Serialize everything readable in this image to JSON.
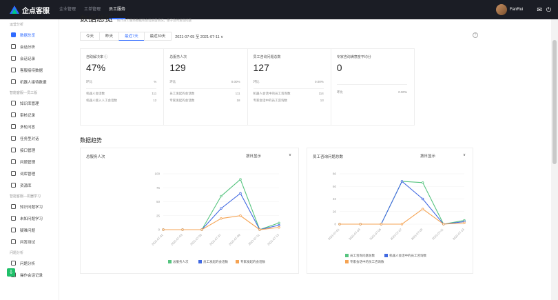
{
  "topbar": {
    "logo_text": "企点客服",
    "nav": [
      "企业管理",
      "工单管理",
      "员工服务"
    ],
    "active_nav": 2,
    "user_name": "FanRui",
    "mail_icon": "mail-icon",
    "logout_icon": "logout-icon"
  },
  "sidebar": {
    "groups": [
      {
        "title": "运营分析",
        "items": [
          "数据总览",
          "会话分析",
          "会话记录",
          "客服接待数据",
          "机器人接待数据"
        ]
      },
      {
        "title": "智能客服—员工版",
        "items": [
          "知识库管理",
          "审核记录",
          "多轮问答",
          "任务型对话",
          "接口管理",
          "问题管理",
          "词库管理",
          "资源库"
        ]
      },
      {
        "title": "智能客服—机器学习",
        "items": [
          "知识问题学习",
          "未知问题学习",
          "疑难问题",
          "问答测试"
        ]
      },
      {
        "title": "问题分析",
        "items": [
          "问题分析",
          "操作会话记录"
        ]
      }
    ],
    "active": "数据总览"
  },
  "main": {
    "title": "数据总览",
    "subtitle": "统计员工服务数据和会话质量情况，便于及时发现问题",
    "filters": [
      "今天",
      "昨天",
      "最近7天",
      "最近30天"
    ],
    "active_filter": 2,
    "date_range": "2021-07-05 至 2021-07-11 ∨",
    "help": "?"
  },
  "cards": [
    {
      "label": "自助解决率 ⓘ",
      "value": "47%",
      "rows": [
        [
          "环比",
          "%"
        ],
        [
          "机器人会话数",
          "111"
        ],
        [
          "机器人接入人工会话数",
          "12"
        ]
      ]
    },
    {
      "label": "总服务人次",
      "value": "129",
      "rows": [
        [
          "环比",
          "0.00%"
        ],
        [
          "员工发起的会话数",
          "111"
        ],
        [
          "专家发起的会话数",
          "18"
        ]
      ]
    },
    {
      "label": "员工咨询问题总数",
      "value": "127",
      "rows": [
        [
          "环比",
          "0.00%"
        ],
        [
          "机器人会话中的员工咨询数",
          "114"
        ],
        [
          "专家会话中的员工咨询数",
          "13"
        ]
      ]
    },
    {
      "label": "专家咨询满意度平均分",
      "value": "0",
      "rows": [
        [
          "",
          ""
        ],
        [
          "",
          ""
        ],
        [
          "环比",
          "0.00%"
        ]
      ]
    }
  ],
  "section_title": "数据趋势",
  "charts_meta": {
    "selector_label": "按日显示",
    "selector_arrow": "∨"
  },
  "chart_data": [
    {
      "type": "line",
      "title": "总服务人次",
      "x": [
        "2021-07-01",
        "2021-07-03",
        "2021-07-05",
        "2021-07-07",
        "2021-07-09",
        "2021-07-11",
        "2021-07-13"
      ],
      "ylim": [
        0,
        100
      ],
      "yticks": [
        0,
        25,
        50,
        75,
        100
      ],
      "series": [
        {
          "name": "总服务人次",
          "color": "#56c47f",
          "values": [
            0,
            0,
            0,
            60,
            90,
            0,
            12
          ]
        },
        {
          "name": "员工发起的会话数",
          "color": "#4169e1",
          "values": [
            0,
            0,
            0,
            38,
            65,
            0,
            8
          ]
        },
        {
          "name": "专家发起的会话数",
          "color": "#f5a353",
          "values": [
            0,
            0,
            0,
            20,
            25,
            0,
            4
          ]
        }
      ]
    },
    {
      "type": "line",
      "title": "员工咨询问题总数",
      "x": [
        "2021-07-01",
        "2021-07-03",
        "2021-07-05",
        "2021-07-07",
        "2021-07-09",
        "2021-07-11",
        "2021-07-13"
      ],
      "ylim": [
        0,
        80
      ],
      "yticks": [
        0,
        20,
        40,
        60,
        80
      ],
      "series": [
        {
          "name": "员工咨询问题总数",
          "color": "#56c47f",
          "values": [
            0,
            0,
            0,
            68,
            66,
            0,
            6
          ]
        },
        {
          "name": "机器人会话中的员工咨询数",
          "color": "#4169e1",
          "values": [
            0,
            0,
            0,
            68,
            40,
            0,
            4
          ]
        },
        {
          "name": "专家会话中的员工咨询数",
          "color": "#f5a353",
          "values": [
            0,
            0,
            0,
            0,
            24,
            0,
            2
          ]
        }
      ]
    }
  ]
}
